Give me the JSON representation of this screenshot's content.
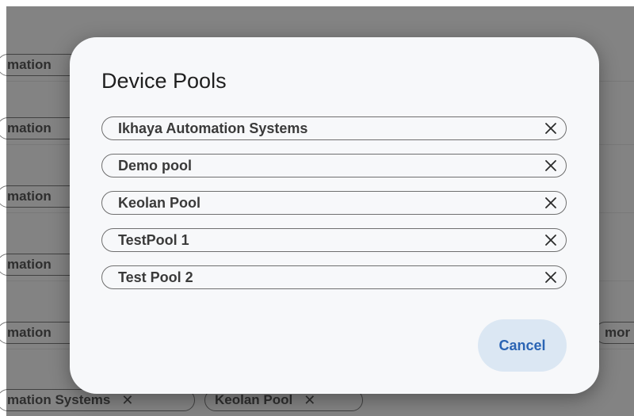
{
  "background": {
    "rows": [
      {
        "left_text": "mation"
      },
      {
        "left_text": "mation"
      },
      {
        "left_text": "mation"
      },
      {
        "left_text": "mation"
      },
      {
        "left_text": "mation",
        "right_text": "mor"
      },
      {
        "left_text": "mation Systems",
        "second_chip": "Keolan Pool"
      }
    ]
  },
  "dialog": {
    "title": "Device Pools",
    "pools": [
      {
        "label": "Ikhaya Automation Systems"
      },
      {
        "label": "Demo pool"
      },
      {
        "label": "Keolan Pool"
      },
      {
        "label": "TestPool 1"
      },
      {
        "label": "Test Pool 2"
      }
    ],
    "cancel_label": "Cancel",
    "remove_icon": "close-icon"
  },
  "colors": {
    "accent": "#2a64b4",
    "cancel_bg": "#dbe7f3",
    "dialog_bg": "#f7f8fa"
  }
}
